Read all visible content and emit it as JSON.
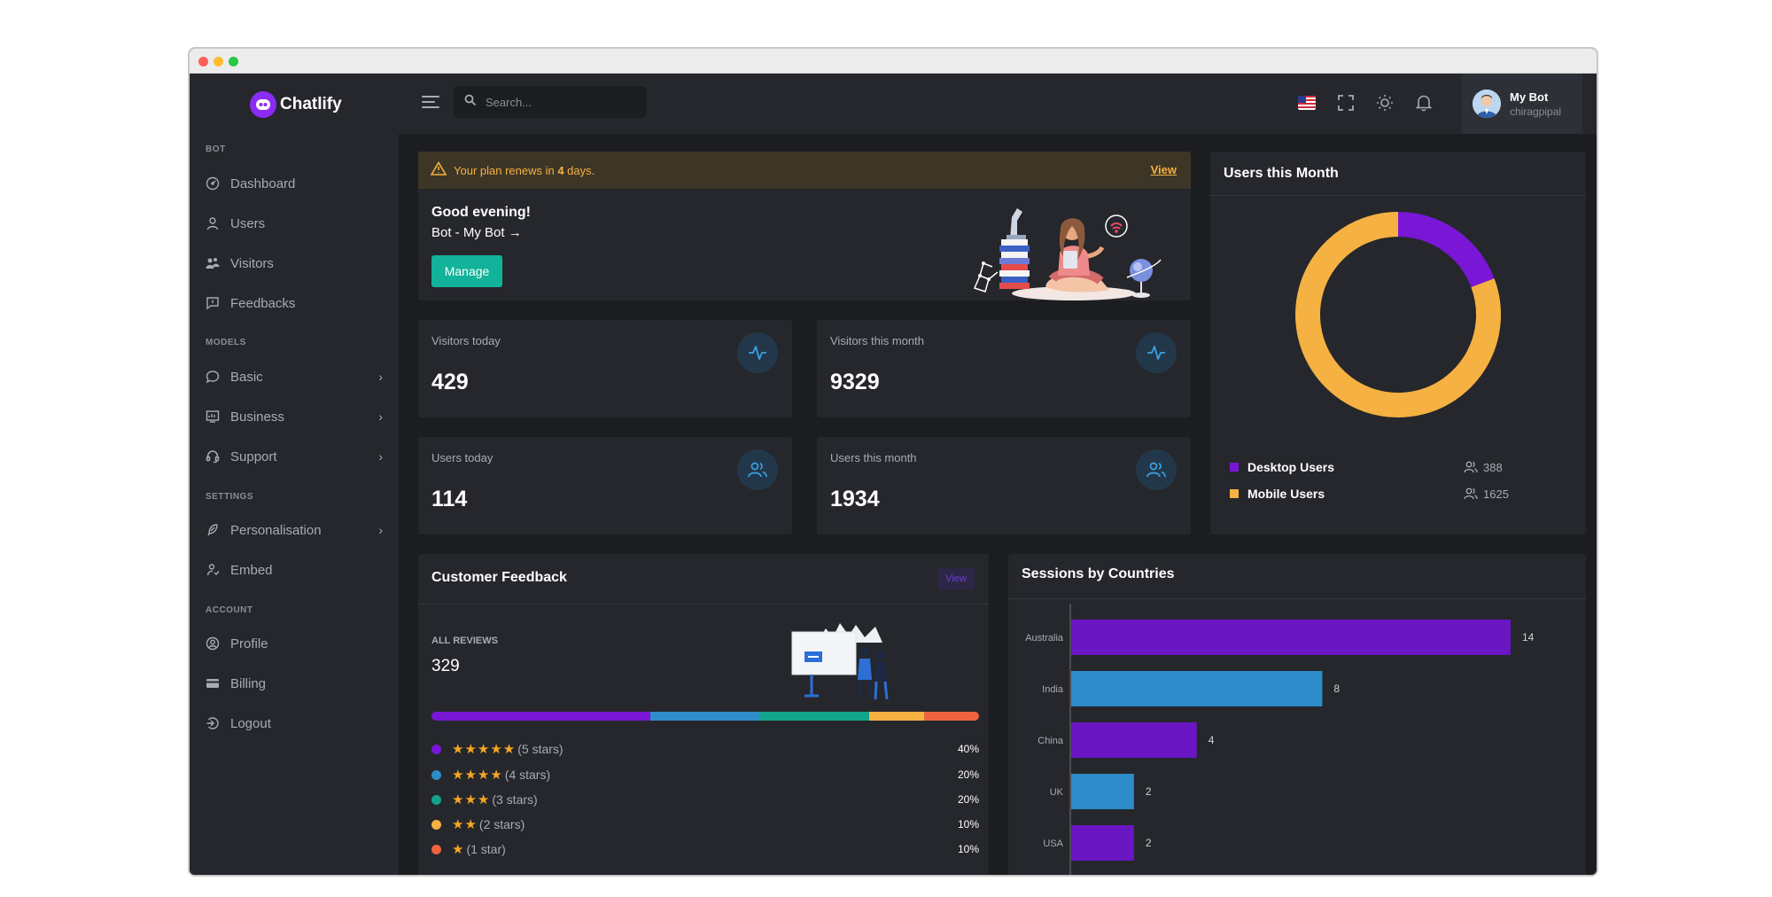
{
  "brand": {
    "name": "Chatlify",
    "accent": "#8b2cf5"
  },
  "sidebar": {
    "sections": [
      {
        "title": "BOT",
        "items": [
          {
            "label": "Dashboard",
            "icon": "dashboard-icon"
          },
          {
            "label": "Users",
            "icon": "user-icon"
          },
          {
            "label": "Visitors",
            "icon": "visitors-icon"
          },
          {
            "label": "Feedbacks",
            "icon": "feedback-icon"
          }
        ]
      },
      {
        "title": "MODELS",
        "items": [
          {
            "label": "Basic",
            "icon": "chat-bubble-icon",
            "has_submenu": true
          },
          {
            "label": "Business",
            "icon": "business-icon",
            "has_submenu": true
          },
          {
            "label": "Support",
            "icon": "headset-icon",
            "has_submenu": true
          }
        ]
      },
      {
        "title": "SETTINGS",
        "items": [
          {
            "label": "Personalisation",
            "icon": "feather-icon",
            "has_submenu": true
          },
          {
            "label": "Embed",
            "icon": "embed-icon"
          }
        ]
      },
      {
        "title": "ACCOUNT",
        "items": [
          {
            "label": "Profile",
            "icon": "profile-icon"
          },
          {
            "label": "Billing",
            "icon": "billing-icon"
          },
          {
            "label": "Logout",
            "icon": "logout-icon"
          }
        ]
      }
    ]
  },
  "header": {
    "search_placeholder": "Search...",
    "user": {
      "name": "My Bot",
      "handle": "chiragpipal"
    }
  },
  "welcome": {
    "alert_prefix": "Your plan renews in ",
    "alert_days": "4",
    "alert_suffix": " days.",
    "alert_link": "View",
    "greeting": "Good evening!",
    "bot_line": "Bot - My Bot",
    "manage_label": "Manage"
  },
  "stats": [
    {
      "label": "Visitors today",
      "value": "429",
      "icon": "activity-icon"
    },
    {
      "label": "Visitors this month",
      "value": "9329",
      "icon": "activity-icon"
    },
    {
      "label": "Users today",
      "value": "114",
      "icon": "users-icon"
    },
    {
      "label": "Users this month",
      "value": "1934",
      "icon": "users-icon"
    }
  ],
  "users_month": {
    "title": "Users this Month",
    "legend": [
      {
        "name": "Desktop Users",
        "value": "388",
        "color": "#7a16d6"
      },
      {
        "name": "Mobile Users",
        "value": "1625",
        "color": "#f5b142"
      }
    ]
  },
  "feedback": {
    "title": "Customer Feedback",
    "view_label": "View",
    "all_reviews_label": "ALL REVIEWS",
    "total": "329",
    "ratings": [
      {
        "stars": "★★★★★",
        "label": "(5 stars)",
        "pct": "40%",
        "color": "#7a16d6",
        "share": 0.4
      },
      {
        "stars": "★★★★",
        "label": "(4 stars)",
        "pct": "20%",
        "color": "#2d8cc9",
        "share": 0.2
      },
      {
        "stars": "★★★",
        "label": "(3 stars)",
        "pct": "20%",
        "color": "#12a38a",
        "share": 0.2
      },
      {
        "stars": "★★",
        "label": "(2 stars)",
        "pct": "10%",
        "color": "#f5b142",
        "share": 0.1
      },
      {
        "stars": "★",
        "label": "(1 star)",
        "pct": "10%",
        "color": "#ef6341",
        "share": 0.1
      }
    ]
  },
  "sessions": {
    "title": "Sessions by Countries"
  },
  "chart_data": [
    {
      "type": "pie",
      "title": "Users this Month",
      "categories": [
        "Desktop Users",
        "Mobile Users"
      ],
      "values": [
        388,
        1625
      ],
      "colors": [
        "#7a16d6",
        "#f5b142"
      ],
      "donut": true
    },
    {
      "type": "bar",
      "orientation": "horizontal",
      "title": "Sessions by Countries",
      "categories": [
        "Australia",
        "India",
        "China",
        "UK",
        "USA"
      ],
      "values": [
        14,
        8,
        4,
        2,
        2
      ],
      "colors": [
        "#6a16c2",
        "#2d8cc9",
        "#6a16c2",
        "#2d8cc9",
        "#6a16c2"
      ],
      "xlim": [
        0,
        14
      ]
    }
  ]
}
